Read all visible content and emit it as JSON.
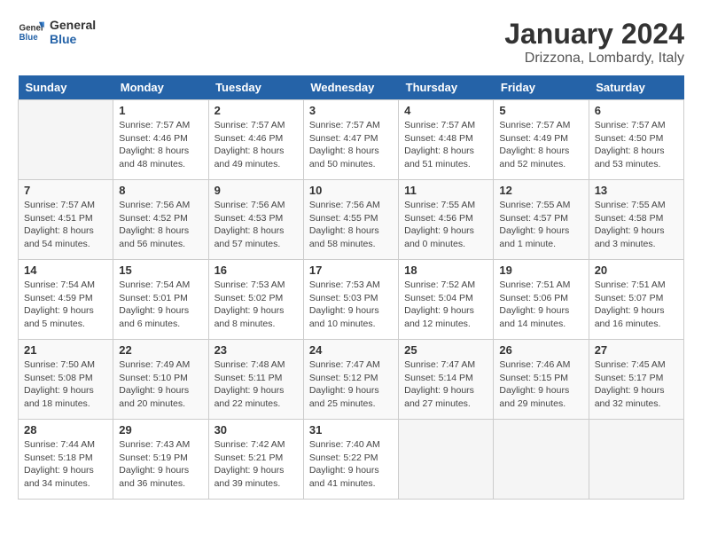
{
  "header": {
    "logo_general": "General",
    "logo_blue": "Blue",
    "month_title": "January 2024",
    "location": "Drizzona, Lombardy, Italy"
  },
  "weekdays": [
    "Sunday",
    "Monday",
    "Tuesday",
    "Wednesday",
    "Thursday",
    "Friday",
    "Saturday"
  ],
  "weeks": [
    [
      {
        "day": "",
        "info": ""
      },
      {
        "day": "1",
        "info": "Sunrise: 7:57 AM\nSunset: 4:46 PM\nDaylight: 8 hours\nand 48 minutes."
      },
      {
        "day": "2",
        "info": "Sunrise: 7:57 AM\nSunset: 4:46 PM\nDaylight: 8 hours\nand 49 minutes."
      },
      {
        "day": "3",
        "info": "Sunrise: 7:57 AM\nSunset: 4:47 PM\nDaylight: 8 hours\nand 50 minutes."
      },
      {
        "day": "4",
        "info": "Sunrise: 7:57 AM\nSunset: 4:48 PM\nDaylight: 8 hours\nand 51 minutes."
      },
      {
        "day": "5",
        "info": "Sunrise: 7:57 AM\nSunset: 4:49 PM\nDaylight: 8 hours\nand 52 minutes."
      },
      {
        "day": "6",
        "info": "Sunrise: 7:57 AM\nSunset: 4:50 PM\nDaylight: 8 hours\nand 53 minutes."
      }
    ],
    [
      {
        "day": "7",
        "info": "Sunrise: 7:57 AM\nSunset: 4:51 PM\nDaylight: 8 hours\nand 54 minutes."
      },
      {
        "day": "8",
        "info": "Sunrise: 7:56 AM\nSunset: 4:52 PM\nDaylight: 8 hours\nand 56 minutes."
      },
      {
        "day": "9",
        "info": "Sunrise: 7:56 AM\nSunset: 4:53 PM\nDaylight: 8 hours\nand 57 minutes."
      },
      {
        "day": "10",
        "info": "Sunrise: 7:56 AM\nSunset: 4:55 PM\nDaylight: 8 hours\nand 58 minutes."
      },
      {
        "day": "11",
        "info": "Sunrise: 7:55 AM\nSunset: 4:56 PM\nDaylight: 9 hours\nand 0 minutes."
      },
      {
        "day": "12",
        "info": "Sunrise: 7:55 AM\nSunset: 4:57 PM\nDaylight: 9 hours\nand 1 minute."
      },
      {
        "day": "13",
        "info": "Sunrise: 7:55 AM\nSunset: 4:58 PM\nDaylight: 9 hours\nand 3 minutes."
      }
    ],
    [
      {
        "day": "14",
        "info": "Sunrise: 7:54 AM\nSunset: 4:59 PM\nDaylight: 9 hours\nand 5 minutes."
      },
      {
        "day": "15",
        "info": "Sunrise: 7:54 AM\nSunset: 5:01 PM\nDaylight: 9 hours\nand 6 minutes."
      },
      {
        "day": "16",
        "info": "Sunrise: 7:53 AM\nSunset: 5:02 PM\nDaylight: 9 hours\nand 8 minutes."
      },
      {
        "day": "17",
        "info": "Sunrise: 7:53 AM\nSunset: 5:03 PM\nDaylight: 9 hours\nand 10 minutes."
      },
      {
        "day": "18",
        "info": "Sunrise: 7:52 AM\nSunset: 5:04 PM\nDaylight: 9 hours\nand 12 minutes."
      },
      {
        "day": "19",
        "info": "Sunrise: 7:51 AM\nSunset: 5:06 PM\nDaylight: 9 hours\nand 14 minutes."
      },
      {
        "day": "20",
        "info": "Sunrise: 7:51 AM\nSunset: 5:07 PM\nDaylight: 9 hours\nand 16 minutes."
      }
    ],
    [
      {
        "day": "21",
        "info": "Sunrise: 7:50 AM\nSunset: 5:08 PM\nDaylight: 9 hours\nand 18 minutes."
      },
      {
        "day": "22",
        "info": "Sunrise: 7:49 AM\nSunset: 5:10 PM\nDaylight: 9 hours\nand 20 minutes."
      },
      {
        "day": "23",
        "info": "Sunrise: 7:48 AM\nSunset: 5:11 PM\nDaylight: 9 hours\nand 22 minutes."
      },
      {
        "day": "24",
        "info": "Sunrise: 7:47 AM\nSunset: 5:12 PM\nDaylight: 9 hours\nand 25 minutes."
      },
      {
        "day": "25",
        "info": "Sunrise: 7:47 AM\nSunset: 5:14 PM\nDaylight: 9 hours\nand 27 minutes."
      },
      {
        "day": "26",
        "info": "Sunrise: 7:46 AM\nSunset: 5:15 PM\nDaylight: 9 hours\nand 29 minutes."
      },
      {
        "day": "27",
        "info": "Sunrise: 7:45 AM\nSunset: 5:17 PM\nDaylight: 9 hours\nand 32 minutes."
      }
    ],
    [
      {
        "day": "28",
        "info": "Sunrise: 7:44 AM\nSunset: 5:18 PM\nDaylight: 9 hours\nand 34 minutes."
      },
      {
        "day": "29",
        "info": "Sunrise: 7:43 AM\nSunset: 5:19 PM\nDaylight: 9 hours\nand 36 minutes."
      },
      {
        "day": "30",
        "info": "Sunrise: 7:42 AM\nSunset: 5:21 PM\nDaylight: 9 hours\nand 39 minutes."
      },
      {
        "day": "31",
        "info": "Sunrise: 7:40 AM\nSunset: 5:22 PM\nDaylight: 9 hours\nand 41 minutes."
      },
      {
        "day": "",
        "info": ""
      },
      {
        "day": "",
        "info": ""
      },
      {
        "day": "",
        "info": ""
      }
    ]
  ]
}
